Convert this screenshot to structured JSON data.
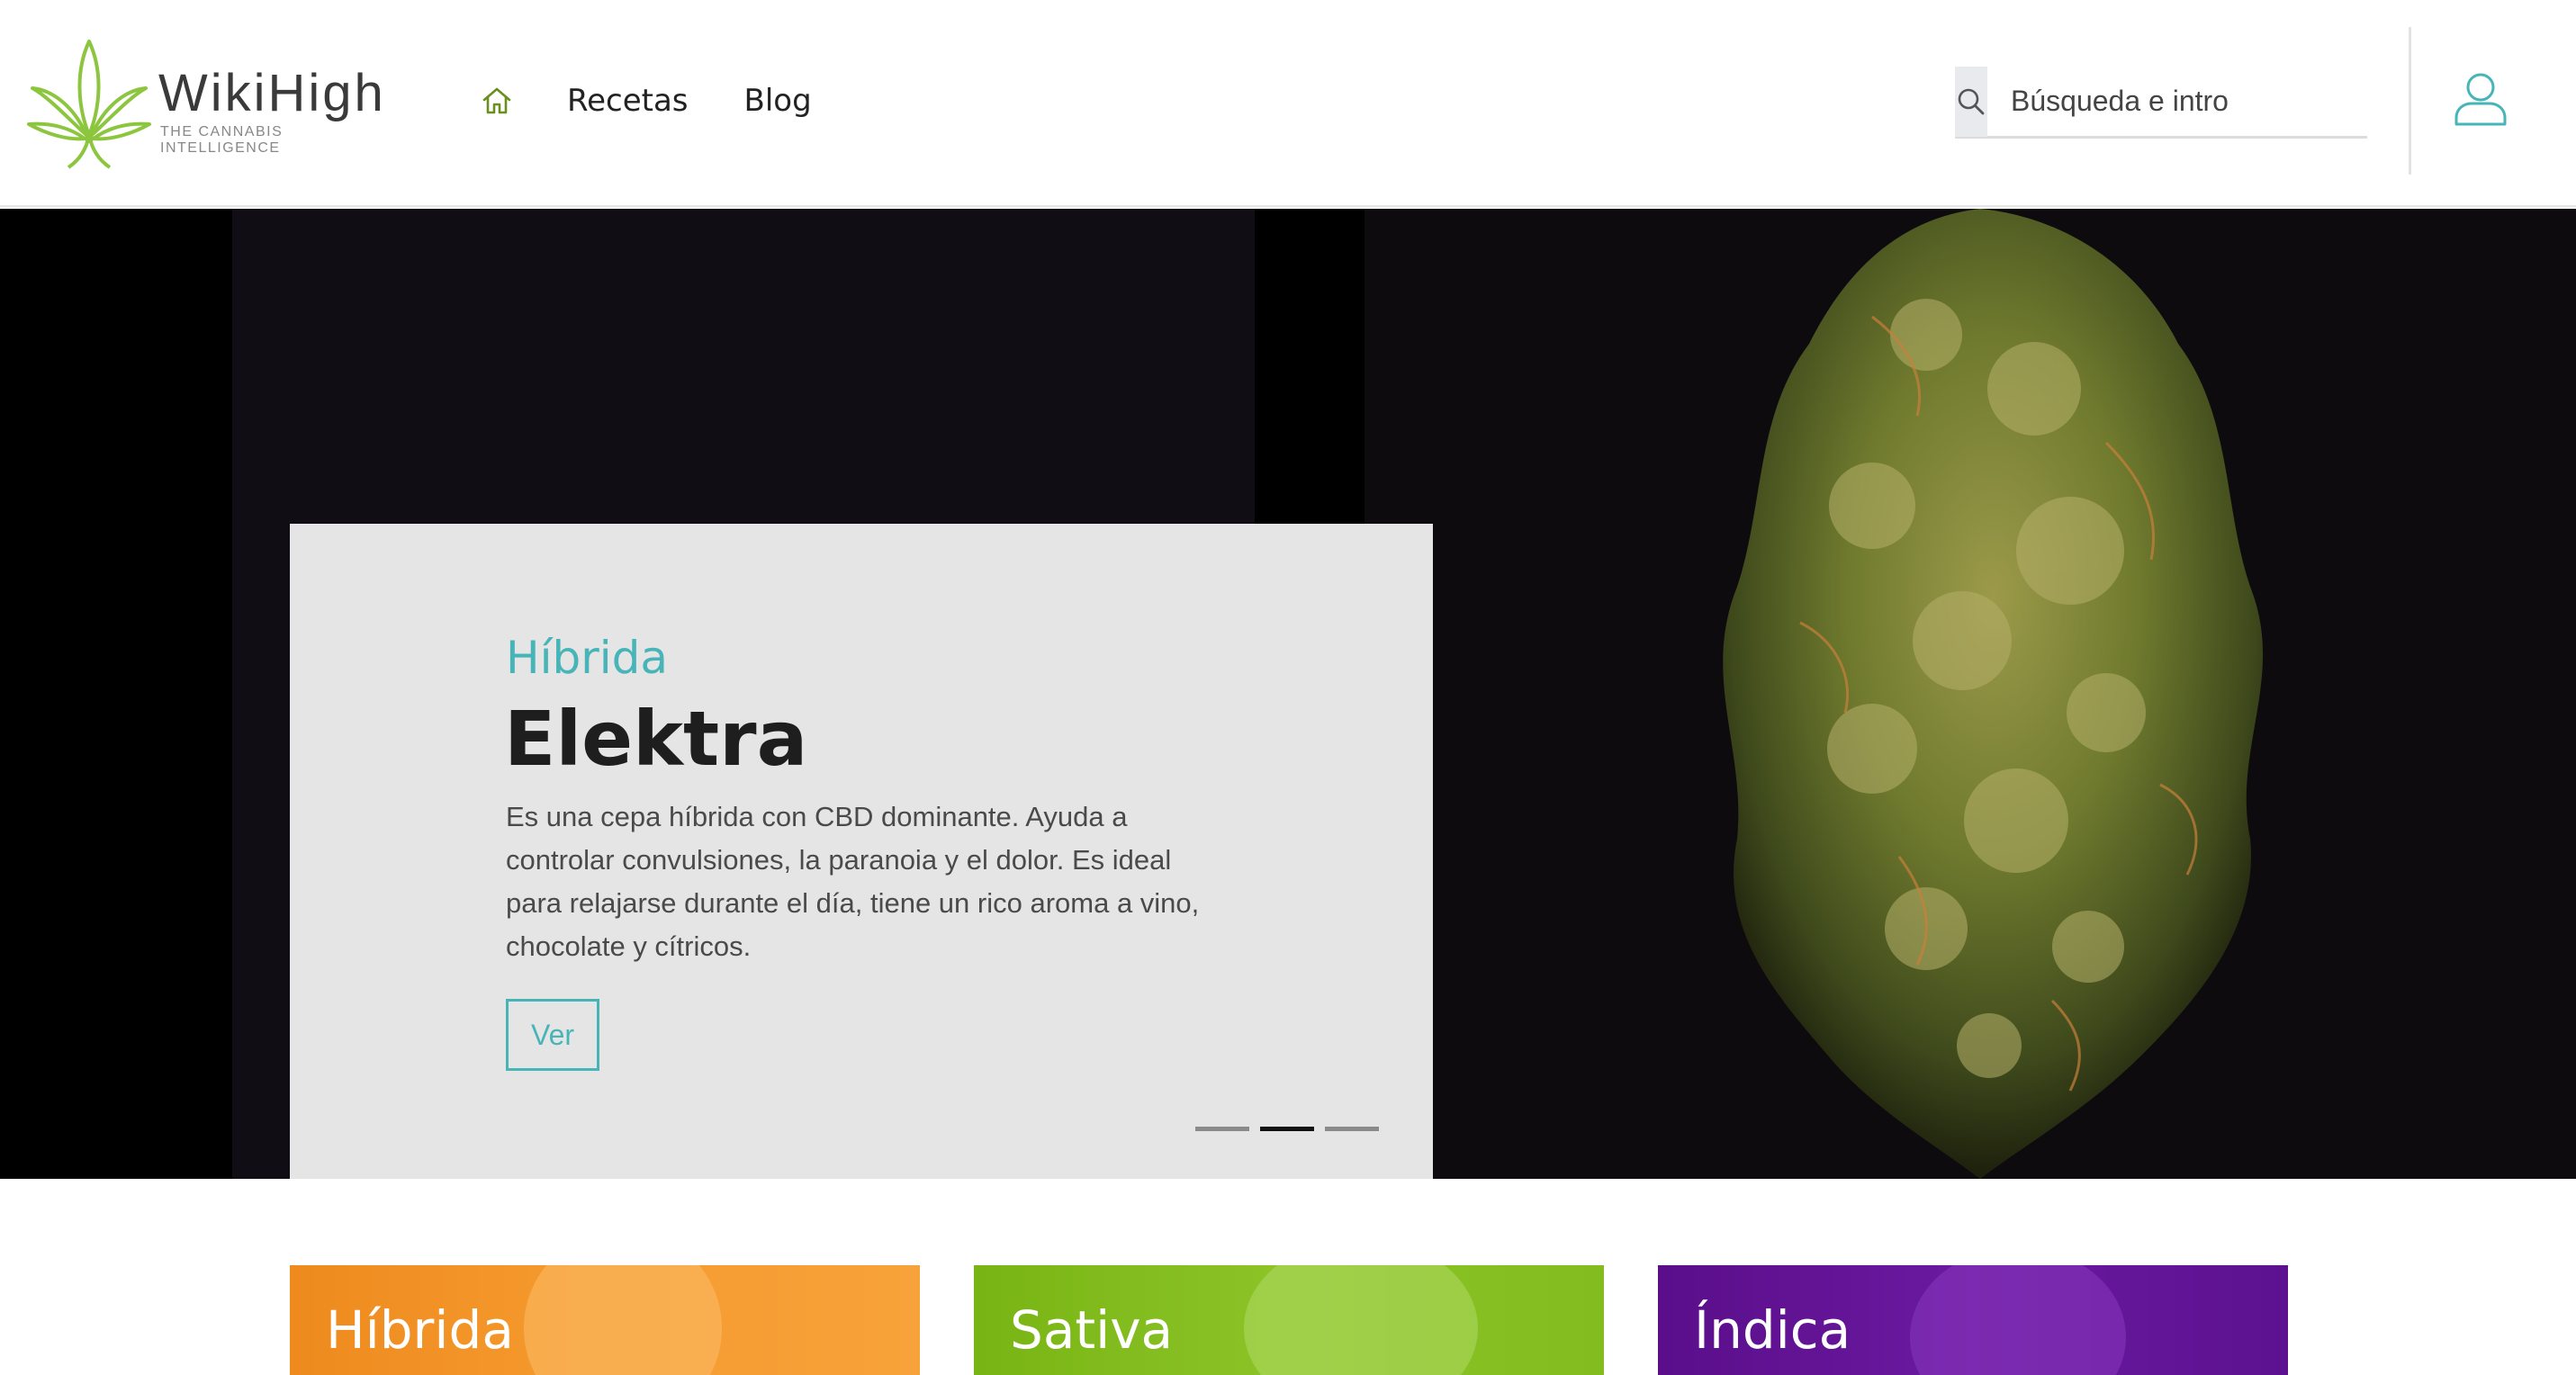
{
  "brand": {
    "name": "WikiHigh",
    "tagline": "THE CANNABIS INTELLIGENCE",
    "leaf_color": "#8cc63f"
  },
  "nav": {
    "home_icon": "home-icon",
    "links": [
      "Recetas",
      "Blog"
    ]
  },
  "search": {
    "icon": "search-icon",
    "placeholder": "Búsqueda e intro",
    "value": ""
  },
  "user": {
    "icon": "user-icon"
  },
  "hero": {
    "category": "Híbrida",
    "title": "Elektra",
    "description": "Es una cepa híbrida con CBD dominante. Ayuda a controlar convulsiones, la paranoia y el dolor. Es ideal para relajarse durante el día, tiene un rico aroma a vino, chocolate y cítricos.",
    "button_label": "Ver",
    "slides_total": 3,
    "active_slide": 2
  },
  "categories": [
    {
      "label": "Híbrida",
      "color": "#f0901f"
    },
    {
      "label": "Sativa",
      "color": "#7db81a"
    },
    {
      "label": "Índica",
      "color": "#5e1490"
    }
  ],
  "colors": {
    "accent": "#47b5b8",
    "card_bg": "#e5e5e5",
    "hero_bg": "#0b0a0c"
  }
}
